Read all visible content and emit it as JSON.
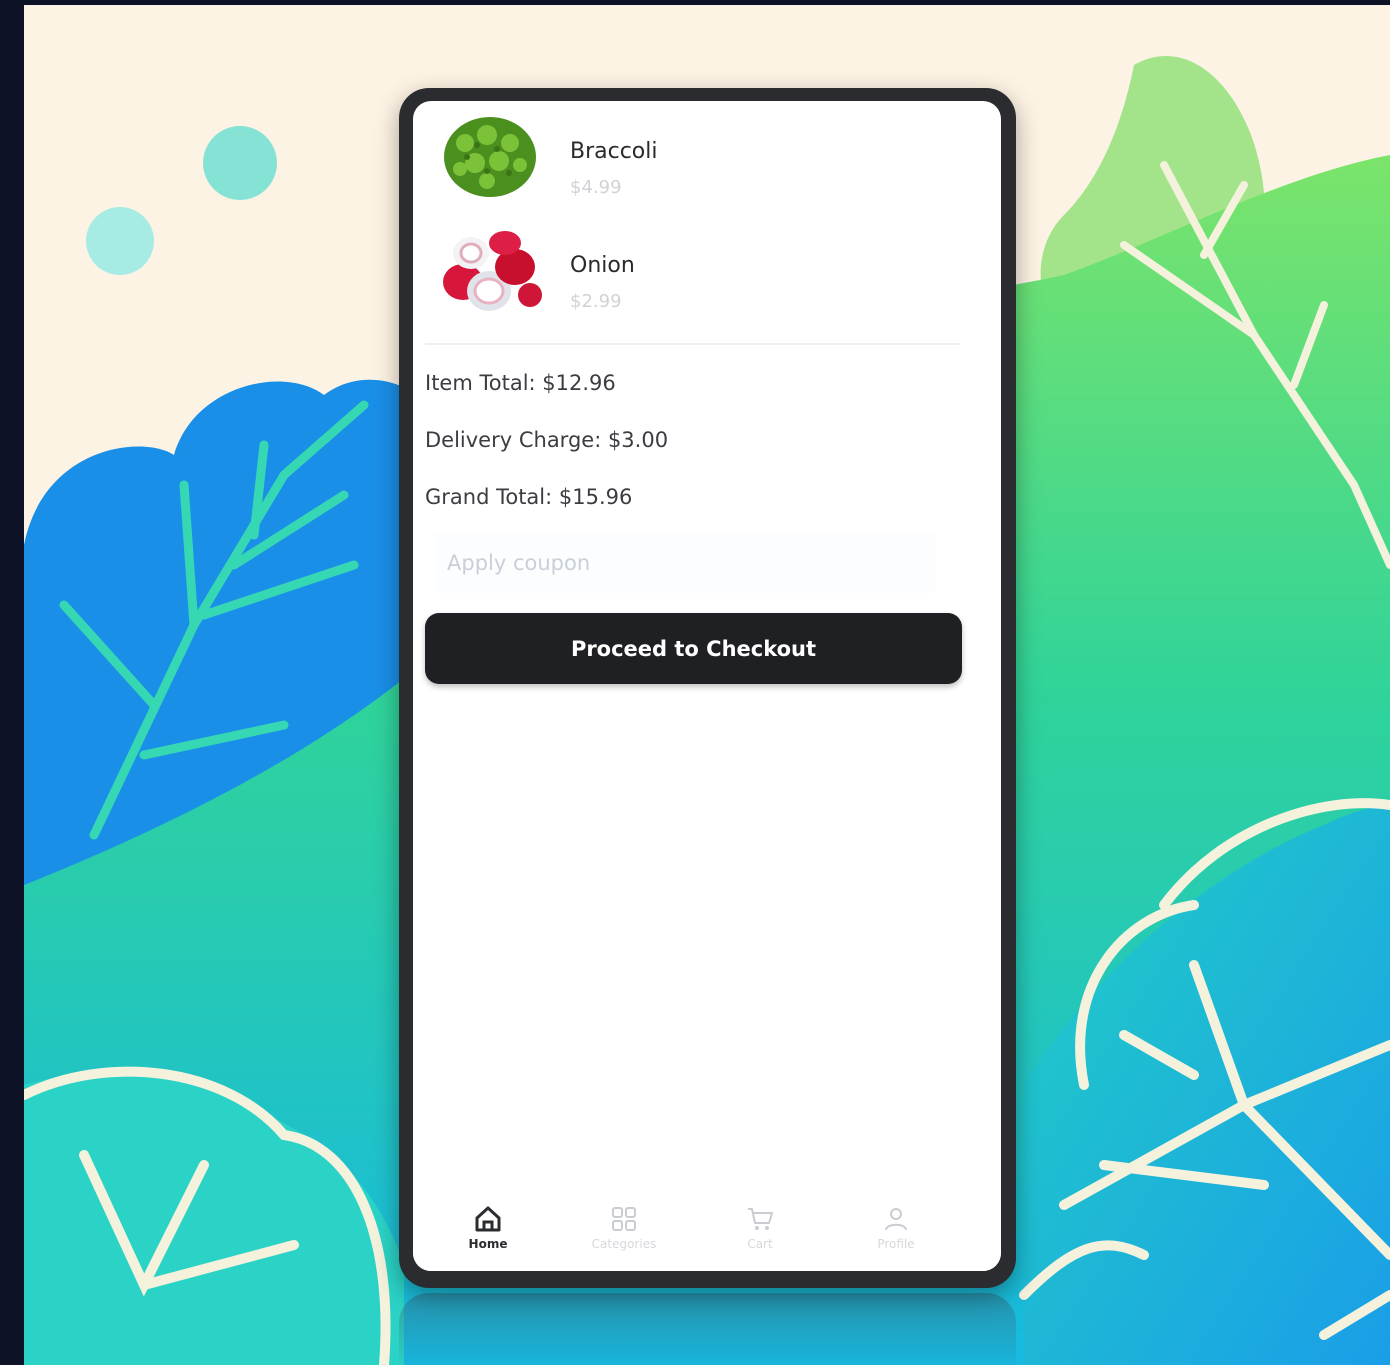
{
  "cart": {
    "items": [
      {
        "name": "Braccoli",
        "price": "$4.99",
        "image": "broccoli-image"
      },
      {
        "name": "Onion",
        "price": "$2.99",
        "image": "onion-image"
      }
    ]
  },
  "summary": {
    "item_total": "Item Total: $12.96",
    "delivery_charge": "Delivery Charge: $3.00",
    "grand_total": "Grand Total: $15.96"
  },
  "coupon": {
    "placeholder": "Apply coupon"
  },
  "checkout": {
    "label": "Proceed to Checkout"
  },
  "tabbar": {
    "active": "Home",
    "tabs": [
      {
        "label": "Home",
        "icon": "home-icon"
      },
      {
        "label": "Categories",
        "icon": "categories-icon"
      },
      {
        "label": "Cart",
        "icon": "cart-icon"
      },
      {
        "label": "Profile",
        "icon": "profile-icon"
      }
    ]
  },
  "colors": {
    "background": "#fdf3e4",
    "leaf_blue": "#1a8fe8",
    "leaf_green": "#5fdc6b",
    "teal": "#1fd0c0",
    "button": "#1f2024"
  }
}
